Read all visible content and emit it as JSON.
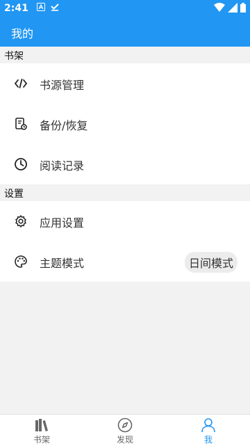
{
  "status_bar": {
    "time": "2:41"
  },
  "app_bar": {
    "title": "我的"
  },
  "sections": {
    "bookshelf": {
      "header": "书架",
      "items": [
        {
          "label": "书源管理",
          "icon": "code-icon"
        },
        {
          "label": "备份/恢复",
          "icon": "backup-restore-icon"
        },
        {
          "label": "阅读记录",
          "icon": "clock-icon"
        }
      ]
    },
    "settings": {
      "header": "设置",
      "items": [
        {
          "label": "应用设置",
          "icon": "gear-icon"
        },
        {
          "label": "主题模式",
          "icon": "palette-icon",
          "value": "日间模式"
        }
      ]
    }
  },
  "bottom_nav": {
    "items": [
      {
        "label": "书架",
        "icon": "books-icon",
        "active": false
      },
      {
        "label": "发现",
        "icon": "compass-icon",
        "active": false
      },
      {
        "label": "我",
        "icon": "person-icon",
        "active": true
      }
    ]
  },
  "colors": {
    "accent": "#2196f3",
    "background": "#f2f2f2",
    "card": "#ffffff"
  }
}
